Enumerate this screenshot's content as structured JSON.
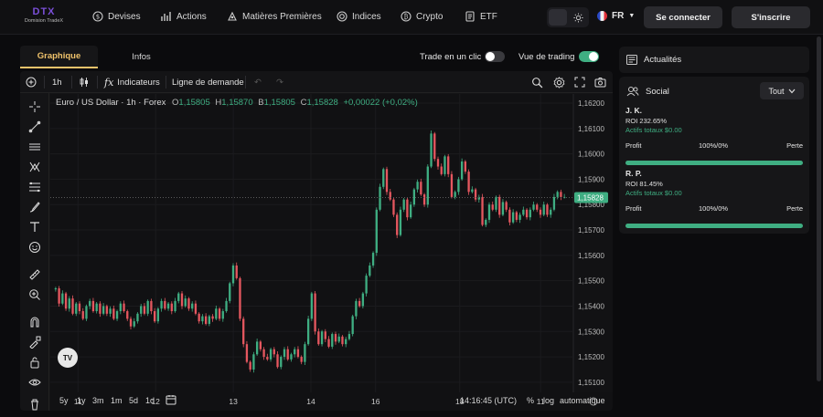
{
  "logo": {
    "mark": "DTX",
    "name": "Domision TradeX"
  },
  "nav": [
    {
      "id": "devises",
      "label": "Devises",
      "icon": "currency-icon"
    },
    {
      "id": "actions",
      "label": "Actions",
      "icon": "bar-chart-icon"
    },
    {
      "id": "matieres",
      "label": "Matières Premières",
      "icon": "commodities-icon"
    },
    {
      "id": "indices",
      "label": "Indices",
      "icon": "indices-icon"
    },
    {
      "id": "crypto",
      "label": "Crypto",
      "icon": "bitcoin-icon"
    },
    {
      "id": "etf",
      "label": "ETF",
      "icon": "document-icon"
    }
  ],
  "header": {
    "language": "FR",
    "login": "Se connecter",
    "signup": "S'inscrire"
  },
  "tabs": {
    "chart": "Graphique",
    "info": "Infos"
  },
  "toggles": {
    "one_click": {
      "label": "Trade en un clic",
      "on": false
    },
    "trading_view": {
      "label": "Vue de trading",
      "on": true
    }
  },
  "toolbar": {
    "interval": "1h",
    "indicators": "Indicateurs",
    "order_line": "Ligne de demande"
  },
  "legend": {
    "symbol": "Euro / US Dollar · 1h · Forex",
    "open": "1,15805",
    "high": "1,15870",
    "low": "1,15805",
    "close": "1,15828",
    "change": "+0,00022 (+0,02%)"
  },
  "chart_data": {
    "type": "candlestick",
    "y_ticks": [
      "1,16200",
      "1,16100",
      "1,16000",
      "1,15900",
      "1,15800",
      "1,15700",
      "1,15600",
      "1,15500",
      "1,15400",
      "1,15300",
      "1,15200",
      "1,15100"
    ],
    "ylim": [
      1.1506,
      1.16236
    ],
    "x_ticks": [
      {
        "label": "11",
        "hour": 8
      },
      {
        "label": "12",
        "hour": 32
      },
      {
        "label": "13",
        "hour": 56
      },
      {
        "label": "14",
        "hour": 80
      },
      {
        "label": "16",
        "hour": 100
      },
      {
        "label": "18",
        "hour": 126
      },
      {
        "label": "11",
        "hour": 151
      }
    ],
    "current_price": "1,15828",
    "current_value": 1.15828,
    "up_color": "#3fae82",
    "down_color": "#e5575f",
    "close": [
      1.1547,
      1.1541,
      1.1545,
      1.1539,
      1.1543,
      1.1537,
      1.1541,
      1.1538,
      1.1535,
      1.154,
      1.1542,
      1.1538,
      1.1541,
      1.1537,
      1.154,
      1.1537,
      1.1539,
      1.1535,
      1.1538,
      1.1541,
      1.1538,
      1.1535,
      1.1532,
      1.1534,
      1.1537,
      1.154,
      1.1537,
      1.1542,
      1.1538,
      1.1534,
      1.1539,
      1.1542,
      1.1539,
      1.1541,
      1.1538,
      1.1542,
      1.1545,
      1.154,
      1.1543,
      1.1539,
      1.1541,
      1.1537,
      1.1534,
      1.1536,
      1.1533,
      1.1536,
      1.1535,
      1.1539,
      1.1535,
      1.1538,
      1.1542,
      1.1549,
      1.1556,
      1.1551,
      1.1535,
      1.1525,
      1.1518,
      1.1515,
      1.1521,
      1.1526,
      1.1523,
      1.152,
      1.1519,
      1.1523,
      1.1521,
      1.1516,
      1.152,
      1.1523,
      1.1519,
      1.1521,
      1.1523,
      1.152,
      1.1518,
      1.1525,
      1.1535,
      1.1545,
      1.153,
      1.1525,
      1.153,
      1.1527,
      1.1524,
      1.1529,
      1.1526,
      1.1528,
      1.1525,
      1.1527,
      1.1529,
      1.1536,
      1.1542,
      1.154,
      1.1545,
      1.1552,
      1.1556,
      1.1561,
      1.1578,
      1.1587,
      1.1594,
      1.1585,
      1.1582,
      1.1576,
      1.1568,
      1.1578,
      1.1582,
      1.1575,
      1.158,
      1.1586,
      1.1589,
      1.1584,
      1.158,
      1.1595,
      1.1608,
      1.1598,
      1.1595,
      1.1592,
      1.1599,
      1.1592,
      1.1583,
      1.1585,
      1.159,
      1.1597,
      1.1593,
      1.1585,
      1.1586,
      1.1582,
      1.1583,
      1.1572,
      1.1574,
      1.158,
      1.1578,
      1.1583,
      1.1576,
      1.1581,
      1.1578,
      1.1573,
      1.1577,
      1.1574,
      1.1576,
      1.1578,
      1.1575,
      1.1578,
      1.158,
      1.1578,
      1.1576,
      1.158,
      1.1576,
      1.1578,
      1.1583,
      1.1585,
      1.1583,
      1.1583
    ]
  },
  "bottom": {
    "ranges": [
      "5y",
      "1y",
      "3m",
      "1m",
      "5d",
      "1d"
    ],
    "time": "14:16:45 (UTC)",
    "pct": "%",
    "log": "log",
    "auto": "automatique"
  },
  "news": {
    "title": "Actualités"
  },
  "social": {
    "title": "Social",
    "filter": "Tout",
    "traders": [
      {
        "name": "J. K.",
        "roi": "ROI 232.65%",
        "assets": "Actifs totaux $0.00",
        "profit_label": "Profit",
        "ratio": "100%/0%",
        "loss_label": "Perte",
        "profit_share": 1.0
      },
      {
        "name": "R. P.",
        "roi": "ROI 81.45%",
        "assets": "Actifs totaux $0.00",
        "profit_label": "Profit",
        "ratio": "100%/0%",
        "loss_label": "Perte",
        "profit_share": 1.0
      }
    ]
  },
  "colors": {
    "accent": "#f0c36b",
    "positive": "#3fae82",
    "negative": "#e5575f",
    "brand": "#7a4fd8"
  }
}
